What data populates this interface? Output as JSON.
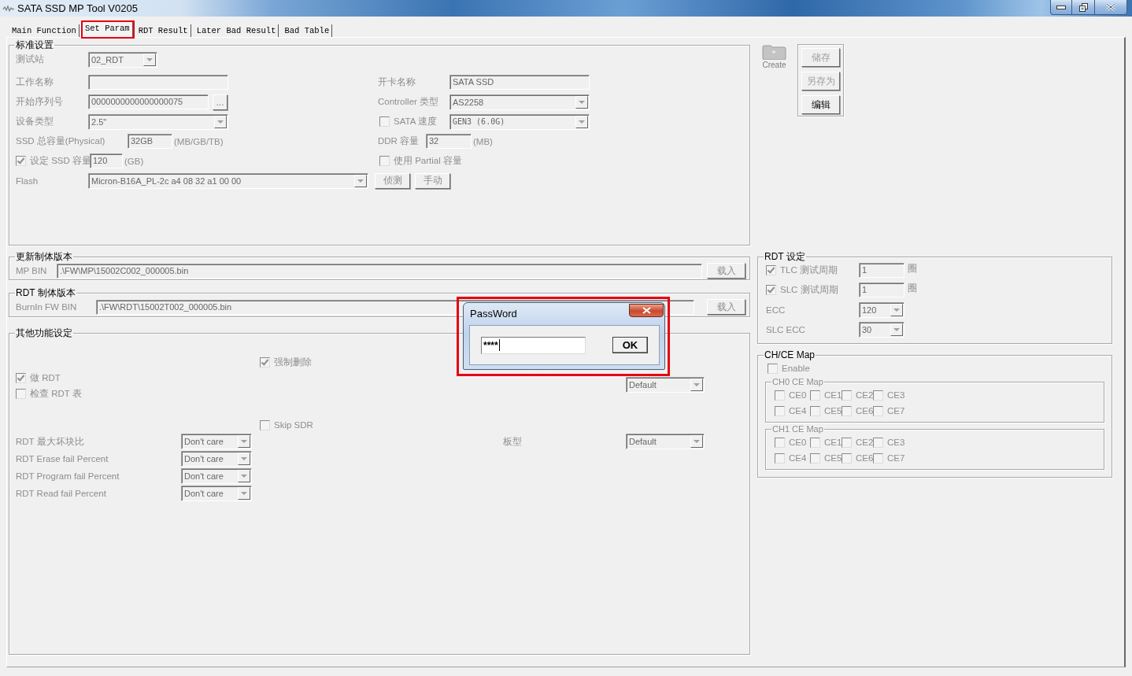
{
  "window": {
    "title": "SATA SSD MP Tool V0205"
  },
  "tabs": [
    {
      "label": "Main Function",
      "selected": false,
      "highlighted": false
    },
    {
      "label": "Set Param",
      "selected": true,
      "highlighted": true
    },
    {
      "label": "RDT Result",
      "selected": false,
      "highlighted": false
    },
    {
      "label": "Later Bad Result",
      "selected": false,
      "highlighted": false
    },
    {
      "label": "Bad Table",
      "selected": false,
      "highlighted": false
    }
  ],
  "standard_settings": {
    "title": "标准设置",
    "disabled": true,
    "test_station": {
      "label": "测试站",
      "value": "02_RDT"
    },
    "work_name": {
      "label": "工作名称"
    },
    "start_serial": {
      "label": "开始序列号",
      "value": "0000000000000000075",
      "button": "..."
    },
    "device_type": {
      "label": "设备类型",
      "value": "2.5\""
    },
    "physical_capacity": {
      "label": "SSD 总容量(Physical)",
      "value": "32GB",
      "unit": "(MB/GB/TB)"
    },
    "set_capacity": {
      "label": "设定 SSD 容量",
      "checked": true,
      "value": "120",
      "unit": "(GB)"
    },
    "flash": {
      "label": "Flash",
      "value": "Micron-B16A_PL-2c a4 08 32 a1 00 00",
      "buttons": [
        "侦测",
        "手动"
      ]
    },
    "card_name": {
      "label": "开卡名称",
      "value": "SATA SSD"
    },
    "controller": {
      "label": "Controller 类型",
      "value": "AS2258"
    },
    "sata_speed": {
      "label": "SATA 速度",
      "checked": false,
      "value": "GEN3 (6.0G)"
    },
    "ddr_capacity": {
      "label": "DDR 容量",
      "value": "32",
      "unit": "(MB)"
    },
    "partial_capacity": {
      "label": "使用 Partial 容量",
      "checked": false
    }
  },
  "profile": {
    "icon_label": "Create",
    "buttons": [
      {
        "label": "储存",
        "disabled": true
      },
      {
        "label": "另存为",
        "disabled": true
      },
      {
        "label": "编辑",
        "disabled": false
      }
    ]
  },
  "mp_firmware": {
    "title": "更新制体版本",
    "disabled": true,
    "label": "MP BIN",
    "value": ".\\FW\\MP\\15002C002_000005.bin",
    "button": "载入"
  },
  "rdt_firmware": {
    "title": "RDT 制体版本",
    "disabled": true,
    "label": "BurnIn FW BIN",
    "value": ".\\FW\\RDT\\15002T002_000005.bin",
    "button": "载入"
  },
  "other_settings": {
    "title": "其他功能设定",
    "disabled": true,
    "force_erase": {
      "label": "强制删除",
      "checked": true
    },
    "do_rdt": {
      "label": "做 RDT",
      "checked": true
    },
    "check_rdt_table": {
      "label": "检查 RDT 表",
      "checked": false
    },
    "skip_sdr": {
      "label": "Skip SDR",
      "checked": false
    },
    "interface_value": "Default",
    "board_type": {
      "label": "板型",
      "value": "Default"
    },
    "percent_rows": [
      {
        "label": "RDT 最大坏块比",
        "value": "Don't care"
      },
      {
        "label": "RDT Erase fail Percent",
        "value": "Don't care"
      },
      {
        "label": "RDT Program fail Percent",
        "value": "Don't care"
      },
      {
        "label": "RDT Read fail Percent",
        "value": "Don't care"
      }
    ]
  },
  "rdt_settings": {
    "title": "RDT 设定",
    "disabled": true,
    "cycles": [
      {
        "label": "TLC 测试周期",
        "checked": true,
        "value": "1",
        "unit": "圈"
      },
      {
        "label": "SLC 测试周期",
        "checked": true,
        "value": "1",
        "unit": "圈"
      }
    ],
    "ecc": [
      {
        "label": "ECC",
        "value": "120"
      },
      {
        "label": "SLC ECC",
        "value": "30"
      }
    ]
  },
  "ce_map": {
    "title": "CH/CE Map",
    "disabled": true,
    "enable": {
      "label": "Enable",
      "checked": false
    },
    "channels": [
      {
        "title": "CH0 CE Map",
        "ces": [
          {
            "label": "CE0",
            "checked": false
          },
          {
            "label": "CE1",
            "checked": false
          },
          {
            "label": "CE2",
            "checked": false
          },
          {
            "label": "CE3",
            "checked": false
          },
          {
            "label": "CE4",
            "checked": false
          },
          {
            "label": "CE5",
            "checked": false
          },
          {
            "label": "CE6",
            "checked": false
          },
          {
            "label": "CE7",
            "checked": false
          }
        ]
      },
      {
        "title": "CH1 CE Map",
        "ces": [
          {
            "label": "CE0",
            "checked": false
          },
          {
            "label": "CE1",
            "checked": false
          },
          {
            "label": "CE2",
            "checked": false
          },
          {
            "label": "CE3",
            "checked": false
          },
          {
            "label": "CE4",
            "checked": false
          },
          {
            "label": "CE5",
            "checked": false
          },
          {
            "label": "CE6",
            "checked": false
          },
          {
            "label": "CE7",
            "checked": false
          }
        ]
      }
    ]
  },
  "password_dialog": {
    "title": "PassWord",
    "value": "****",
    "ok": "OK",
    "highlighted": true
  }
}
